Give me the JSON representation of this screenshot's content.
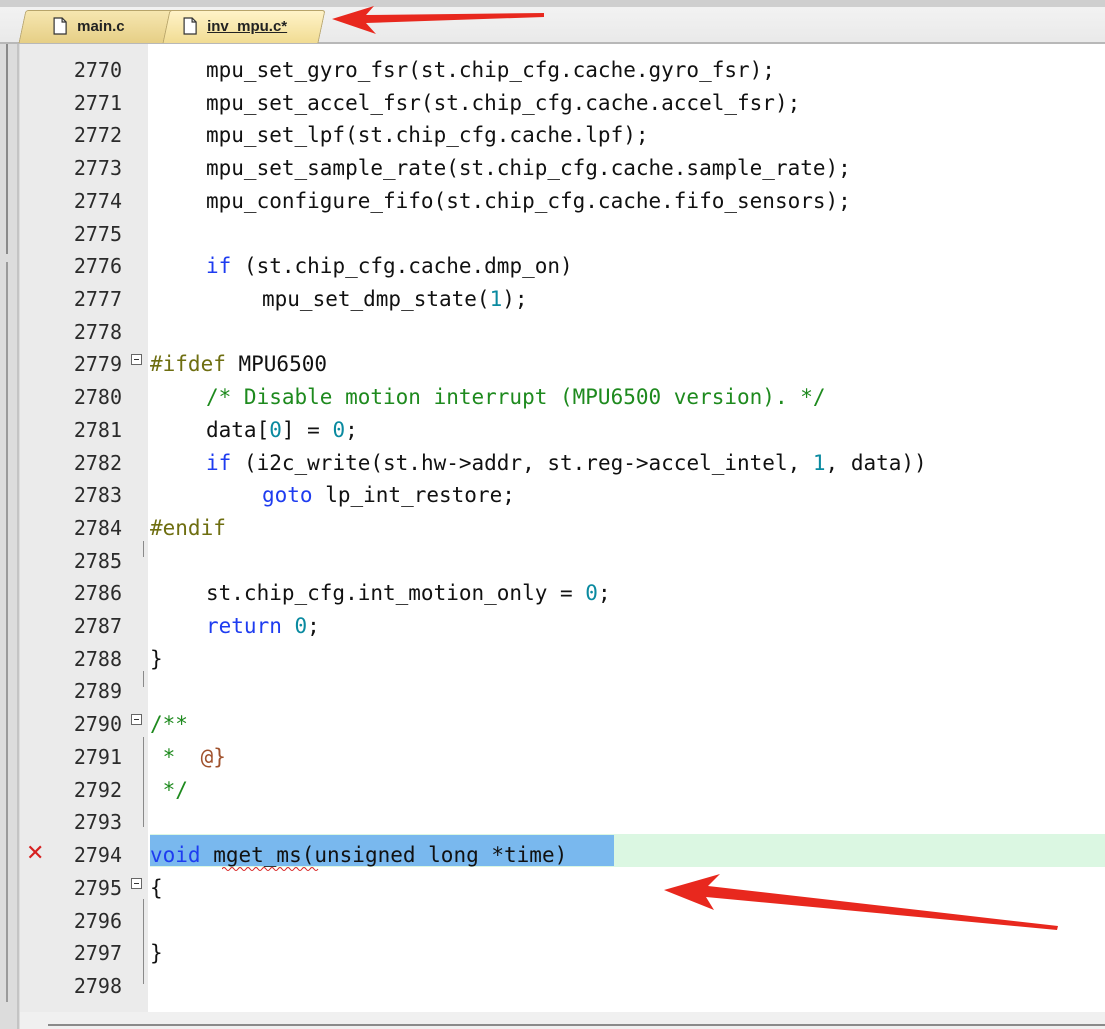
{
  "tabs": [
    {
      "label": "main.c",
      "active": false
    },
    {
      "label": "inv_mpu.c*",
      "active": true
    }
  ],
  "lines": [
    {
      "n": "2770"
    },
    {
      "n": "2771"
    },
    {
      "n": "2772"
    },
    {
      "n": "2773"
    },
    {
      "n": "2774"
    },
    {
      "n": "2775"
    },
    {
      "n": "2776"
    },
    {
      "n": "2777"
    },
    {
      "n": "2778"
    },
    {
      "n": "2779"
    },
    {
      "n": "2780"
    },
    {
      "n": "2781"
    },
    {
      "n": "2782"
    },
    {
      "n": "2783"
    },
    {
      "n": "2784"
    },
    {
      "n": "2785"
    },
    {
      "n": "2786"
    },
    {
      "n": "2787"
    },
    {
      "n": "2788"
    },
    {
      "n": "2789"
    },
    {
      "n": "2790"
    },
    {
      "n": "2791"
    },
    {
      "n": "2792"
    },
    {
      "n": "2793"
    },
    {
      "n": "2794"
    },
    {
      "n": "2795"
    },
    {
      "n": "2796"
    },
    {
      "n": "2797"
    },
    {
      "n": "2798"
    }
  ],
  "code": {
    "l2770": "mpu_set_gyro_fsr(st.chip_cfg.cache.gyro_fsr);",
    "l2771": "mpu_set_accel_fsr(st.chip_cfg.cache.accel_fsr);",
    "l2772": "mpu_set_lpf(st.chip_cfg.cache.lpf);",
    "l2773": "mpu_set_sample_rate(st.chip_cfg.cache.sample_rate);",
    "l2774": "mpu_configure_fifo(st.chip_cfg.cache.fifo_sensors);",
    "l2776_kw": "if",
    "l2776_rest": " (st.chip_cfg.cache.dmp_on)",
    "l2777_a": "mpu_set_dmp_state(",
    "l2777_num": "1",
    "l2777_b": ");",
    "l2779_pp": "#ifdef",
    "l2779_rest": " MPU6500",
    "l2780": "/* Disable motion interrupt (MPU6500 version). */",
    "l2781_a": "data[",
    "l2781_num1": "0",
    "l2781_b": "] = ",
    "l2781_num2": "0",
    "l2781_c": ";",
    "l2782_kw": "if",
    "l2782_a": " (i2c_write(st.hw->addr, st.reg->accel_intel, ",
    "l2782_num": "1",
    "l2782_b": ", data))",
    "l2783_kw": "goto",
    "l2783_rest": " lp_int_restore;",
    "l2784": "#endif",
    "l2786_a": "st.chip_cfg.int_motion_only = ",
    "l2786_num": "0",
    "l2786_b": ";",
    "l2787_kw": "return",
    "l2787_num": " 0",
    "l2787_b": ";",
    "l2788": "}",
    "l2790": "/**",
    "l2791_a": " *  ",
    "l2791_at": "@}",
    "l2792": " */",
    "l2794_kw": "void",
    "l2794_name": " mget_ms",
    "l2794_rest": "(unsigned long *time)",
    "l2795": "{",
    "l2797": "}"
  },
  "markers": {
    "error_symbol": "✕",
    "error_line": "2794"
  },
  "colors": {
    "keyword": "#1e3cf0",
    "number": "#0a8aa0",
    "comment": "#1e8a1e",
    "preprocessor": "#6e6e10",
    "selection": "#79b8ee",
    "current_line": "#dbf7e2",
    "error": "#d62020",
    "annotation_arrow": "#e8281e"
  },
  "icons": [
    "file-icon",
    "fold-collapse-icon",
    "error-x-icon",
    "annotation-arrow"
  ]
}
